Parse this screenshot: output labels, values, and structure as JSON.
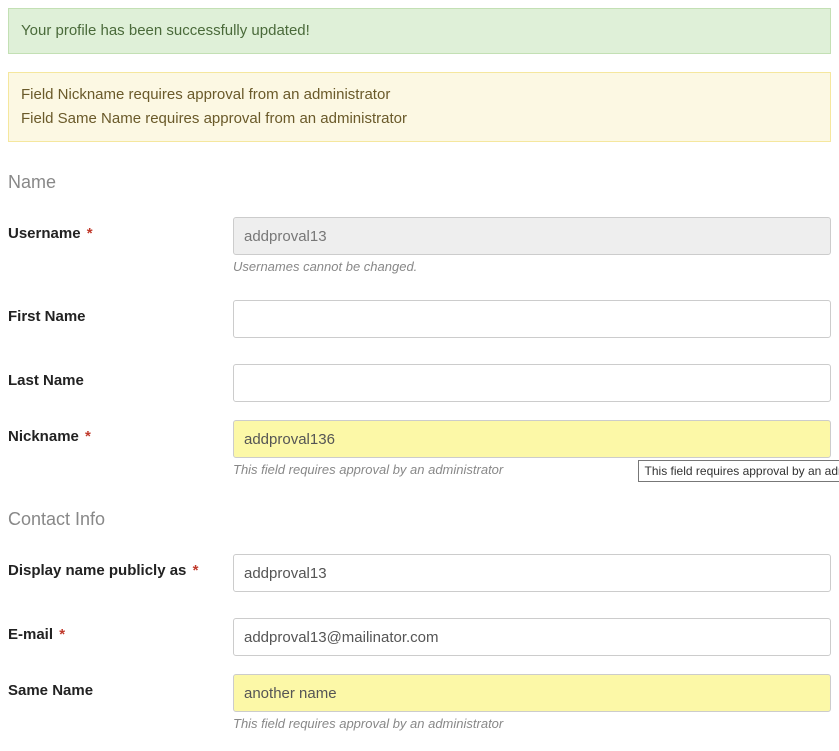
{
  "alerts": {
    "success": "Your profile has been successfully updated!",
    "warning_line1": "Field Nickname requires approval from an administrator",
    "warning_line2": "Field Same Name requires approval from an administrator"
  },
  "sections": {
    "name_title": "Name",
    "contact_title": "Contact Info"
  },
  "fields": {
    "username": {
      "label": "Username",
      "value": "addproval13",
      "helper": "Usernames cannot be changed."
    },
    "first_name": {
      "label": "First Name",
      "value": ""
    },
    "last_name": {
      "label": "Last Name",
      "value": ""
    },
    "nickname": {
      "label": "Nickname",
      "value": "addproval136",
      "helper": "This field requires approval by an administrator"
    },
    "display_name": {
      "label": "Display name publicly as",
      "value": "addproval13"
    },
    "email": {
      "label": "E-mail",
      "value": "addproval13@mailinator.com"
    },
    "same_name": {
      "label": "Same Name",
      "value": "another name",
      "helper": "This field requires approval by an administrator"
    }
  },
  "tooltip": "This field requires approval by an administrator",
  "required_mark": "*"
}
